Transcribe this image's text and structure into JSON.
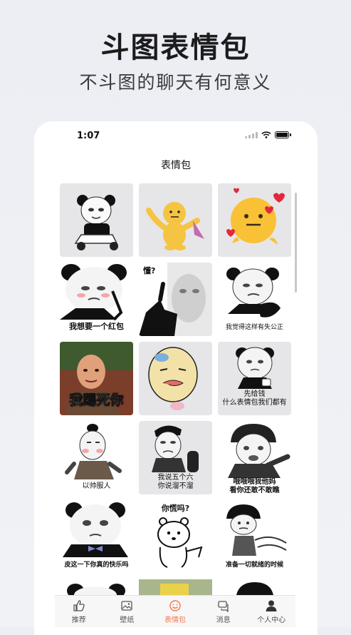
{
  "promo": {
    "title": "斗图表情包",
    "subtitle": "不斗图的聊天有何意义"
  },
  "status_bar": {
    "time": "1:07"
  },
  "header": {
    "title": "表情包"
  },
  "stickers": [
    {
      "caption": "",
      "icon": "panda-scooter-icon"
    },
    {
      "caption": "",
      "icon": "yellow-doll-icon"
    },
    {
      "caption": "",
      "icon": "emoji-hearts-icon"
    },
    {
      "caption": "我想要一个红包",
      "icon": "panda-phone-icon"
    },
    {
      "caption": "懂?",
      "icon": "blurry-face-icon"
    },
    {
      "caption": "我觉得这样有失公正",
      "icon": "panda-hand-icon"
    },
    {
      "caption": "我踢死你",
      "icon": "bald-man-photo-icon"
    },
    {
      "caption": "",
      "icon": "tongue-face-icon"
    },
    {
      "caption": "先给钱\n什么表情包我们都有",
      "icon": "panda-cup-icon"
    },
    {
      "caption": "以帅服人",
      "icon": "buff-man-icon"
    },
    {
      "caption": "我说五个六\n你说溜不溜",
      "icon": "speaker-man-icon"
    },
    {
      "caption": "哦哦哦我他妈\n看你还敢不敢瞧",
      "icon": "helmet-man-icon"
    },
    {
      "caption": "皮这一下你真的快乐吗",
      "icon": "panda-bowtie-icon"
    },
    {
      "caption": "你慌吗?",
      "icon": "bear-pointing-icon"
    },
    {
      "caption": "准备一切就绪的时候",
      "icon": "mushroom-kid-icon"
    }
  ],
  "tabs": [
    {
      "label": "推荐",
      "icon": "thumbs-up-icon",
      "active": false
    },
    {
      "label": "壁纸",
      "icon": "picture-icon",
      "active": false
    },
    {
      "label": "表情包",
      "icon": "smiley-icon",
      "active": true
    },
    {
      "label": "消息",
      "icon": "chat-icon",
      "active": false
    },
    {
      "label": "个人中心",
      "icon": "person-icon",
      "active": false
    }
  ],
  "colors": {
    "accent": "#f07a50",
    "text": "#111111"
  }
}
